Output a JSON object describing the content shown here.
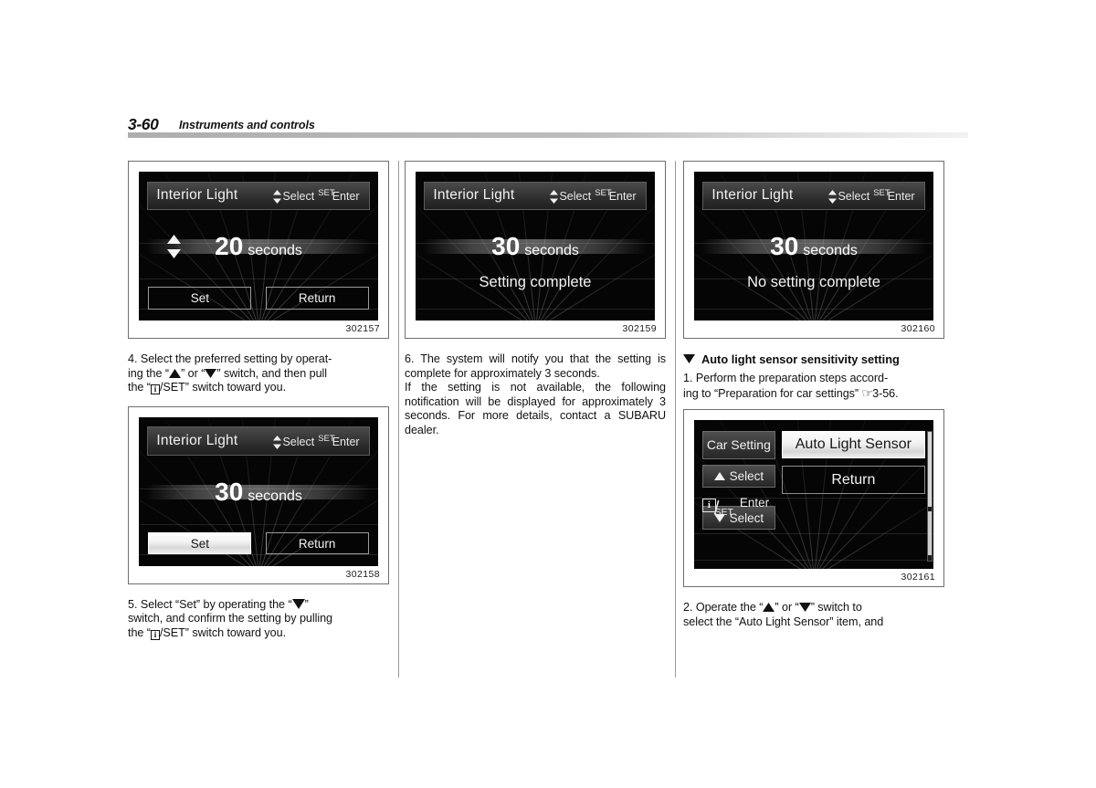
{
  "page": {
    "folio": "3-60",
    "chapter": "Instruments and controls"
  },
  "columns": {
    "col1": {
      "figures": [
        {
          "id": "302157",
          "screen": {
            "title": "Interior Light",
            "hint_select": "Select",
            "hint_set": "SET",
            "hint_enter": "Enter",
            "value": "20",
            "unit": "seconds",
            "has_value_arrows": true,
            "message": "",
            "buttons": [
              {
                "label": "Set",
                "selected": false
              },
              {
                "label": "Return",
                "selected": false
              }
            ]
          }
        },
        {
          "id": "302158",
          "screen": {
            "title": "Interior Light",
            "hint_select": "Select",
            "hint_set": "SET",
            "hint_enter": "Enter",
            "value": "30",
            "unit": "seconds",
            "has_value_arrows": false,
            "message": "",
            "buttons": [
              {
                "label": "Set",
                "selected": true
              },
              {
                "label": "Return",
                "selected": false
              }
            ]
          }
        }
      ],
      "step4_a": "4.   Select the preferred setting by operat-",
      "step4_b_pre": "ing the “",
      "step4_b_mid": "” or “",
      "step4_b_post": "” switch, and then pull",
      "step4_c_pre": "the “",
      "step4_c_post": "/SET” switch toward you.",
      "step5_a_pre": "5.  Select “Set” by operating the “",
      "step5_a_post": "”",
      "step5_b": "switch, and confirm the setting by pulling",
      "step5_c_pre": "the “",
      "step5_c_post": "/SET” switch toward you."
    },
    "col2": {
      "figures": [
        {
          "id": "302159",
          "screen": {
            "title": "Interior Light",
            "hint_select": "Select",
            "hint_set": "SET",
            "hint_enter": "Enter",
            "value": "30",
            "unit": "seconds",
            "has_value_arrows": false,
            "message": "Setting complete",
            "buttons": []
          }
        }
      ],
      "step6": "6.  The system will notify you that the setting is complete for approximately 3 seconds.",
      "note": "If the setting is not available, the following notification will be displayed for approximately 3 seconds. For more details, contact a SUBARU dealer."
    },
    "col3": {
      "figures": [
        {
          "id": "302160",
          "screen": {
            "title": "Interior Light",
            "hint_select": "Select",
            "hint_set": "SET",
            "hint_enter": "Enter",
            "value": "30",
            "unit": "seconds",
            "has_value_arrows": false,
            "message": "No setting complete",
            "buttons": []
          }
        },
        {
          "id": "302161",
          "car_setting": {
            "header_chip": "Car Setting",
            "select_up": "Select",
            "select_down": "Select",
            "enter_label": "Enter",
            "enter_set": "SET",
            "items": [
              {
                "label": "Auto Light Sensor",
                "selected": true
              },
              {
                "label": "Return",
                "selected": false
              }
            ]
          }
        }
      ],
      "section_heading": "Auto light sensor sensitivity setting",
      "step1_a": "1.   Perform the preparation steps accord-",
      "step1_b_pre": "ing to “Preparation for car settings” ",
      "step1_b_ref": "3-56.",
      "step2_a_pre": "2.  Operate the “",
      "step2_a_mid": "” or “",
      "step2_a_post": "” switch to",
      "step2_b": "select the “Auto Light Sensor” item, and"
    }
  },
  "icons": {
    "up_triangle": "up-triangle-icon",
    "down_triangle": "down-triangle-icon",
    "up_down": "up-down-arrows-icon",
    "info_box": "info-box-icon",
    "pointing_hand": "pointing-hand-icon",
    "section_marker": "down-triangle-section-marker-icon"
  },
  "colors": {
    "page_bg": "#ffffff",
    "text": "#111111",
    "lcd_bg": "#050505",
    "lcd_text": "#f2f2f2",
    "rule": "#9a9a9a",
    "header_rule": "#bdbdbd"
  }
}
